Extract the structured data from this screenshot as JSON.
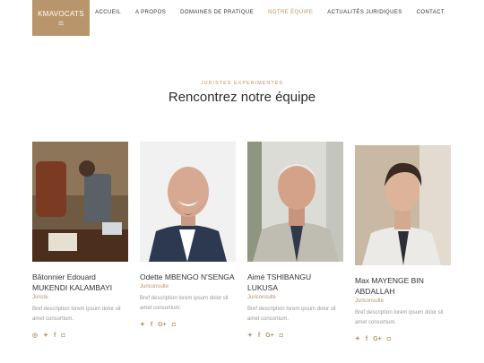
{
  "brand": {
    "name": "KMAVOCATS",
    "mark": "⚖"
  },
  "nav": [
    "ACCUEIL",
    "A PROPOS",
    "DOMAINES DE PRATIQUE",
    "NOTRE ÉQUIPE",
    "ACTUALITÉS JURIDIQUES",
    "CONTACT"
  ],
  "nav_active": "NOTRE ÉQUIPE",
  "section": {
    "eyebrow": "JURISTES EXPERIMENTÉS",
    "title": "Rencontrez notre équipe"
  },
  "team": [
    {
      "name": "Bâtonnier Edouard MUKENDI KALAMBAYI",
      "role": "Juriste",
      "desc": "Bref description lorem ipsum dolor sit amet consortium.",
      "socials": [
        "whatsapp-icon",
        "twitter-icon",
        "facebook-icon",
        "instagram-icon"
      ]
    },
    {
      "name": "Odette MBENGO N'SENGA",
      "role": "Juriconsulte",
      "desc": "Bref description lorem ipsum dolor sit amet consortium.",
      "socials": [
        "twitter-icon",
        "facebook-icon",
        "google-plus-icon",
        "instagram-icon"
      ]
    },
    {
      "name": "Aimé TSHIBANGU LUKUSA",
      "role": "Juriconsulte",
      "desc": "Bref description lorem ipsum dolor sit amet consortium.",
      "socials": [
        "twitter-icon",
        "facebook-icon",
        "google-plus-icon",
        "instagram-icon"
      ]
    },
    {
      "name": "Max MAYENGE BIN ABDALLAH",
      "role": "Juriconsulte",
      "desc": "Bref description lorem ipsum dolor sit amet consortium.",
      "socials": [
        "twitter-icon",
        "facebook-icon",
        "google-plus-icon",
        "instagram-icon"
      ]
    }
  ],
  "colors": {
    "accent": "#b8956a",
    "text": "#333333",
    "muted": "#999999"
  }
}
